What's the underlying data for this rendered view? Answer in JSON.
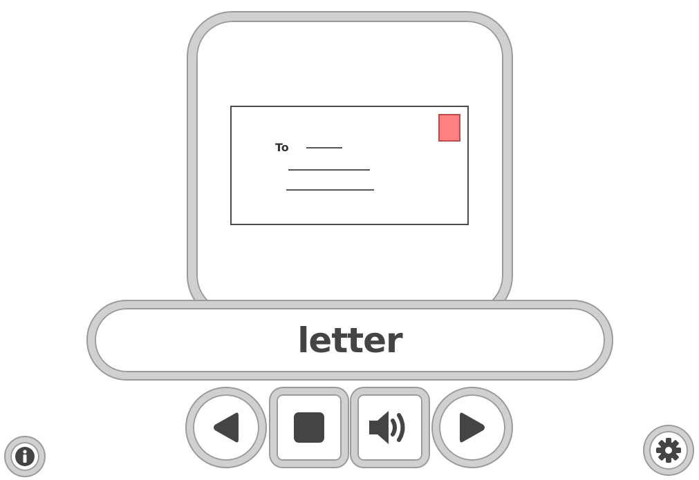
{
  "card": {
    "envelope": {
      "to_label": "To"
    }
  },
  "word": "letter",
  "controls": [
    {
      "name": "previous",
      "icon": "triangle-left-icon"
    },
    {
      "name": "stop",
      "icon": "stop-square-icon"
    },
    {
      "name": "play-sound",
      "icon": "speaker-icon"
    },
    {
      "name": "next",
      "icon": "triangle-right-icon"
    }
  ],
  "corner": {
    "info_icon": "info-icon",
    "settings_icon": "gear-icon"
  },
  "colors": {
    "border": "#d0d0d0",
    "outline": "#9a9a9a",
    "icon": "#444444",
    "stamp": "#ff8080"
  }
}
